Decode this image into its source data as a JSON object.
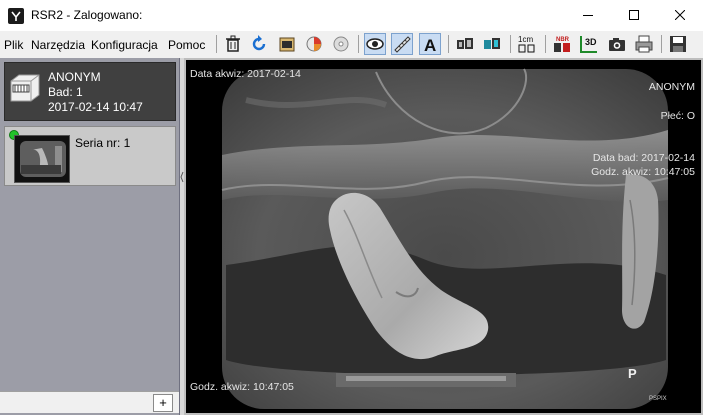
{
  "window": {
    "title": "RSR2 - Zalogowano:",
    "controls": {
      "minimize": "minimize",
      "maximize": "maximize",
      "close": "close"
    }
  },
  "menu": {
    "items": [
      "Plik",
      "Narzędzia",
      "Konfiguracja",
      "Pomoc"
    ]
  },
  "toolbar": {
    "icons": [
      "trash-icon",
      "rotate-icon",
      "film-icon",
      "color-wheel-icon",
      "disc-icon",
      "eye-icon",
      "ruler-icon",
      "text-annotation-icon",
      "teeth-icon",
      "teeth-color-icon",
      "measure-1cm-icon",
      "histogram-icon",
      "view-3d-icon",
      "camera-icon",
      "print-icon",
      "save-icon"
    ],
    "ruler_label": "1cm",
    "nbr_label": "NBR",
    "view3d_label": "3D",
    "text_label": "A"
  },
  "patient": {
    "name": "ANONYM",
    "bad": "Bad: 1",
    "date": "2017-02-14   10:47"
  },
  "series": {
    "label": "Seria nr: 1",
    "status_color": "#22c32a"
  },
  "left_panel": {
    "add_label": "+"
  },
  "viewer": {
    "acq_date": "Data akwiz: 2017-02-14",
    "patient_name": "ANONYM",
    "sex": "Płeć: O",
    "exam_date": "Data bad: 2017-02-14",
    "acq_time_right": "Godz. akwiz: 10:47:05",
    "acq_time_bottom": "Godz. akwiz: 10:47:05",
    "orientation": "P",
    "sensor_label": "PSPIX"
  }
}
